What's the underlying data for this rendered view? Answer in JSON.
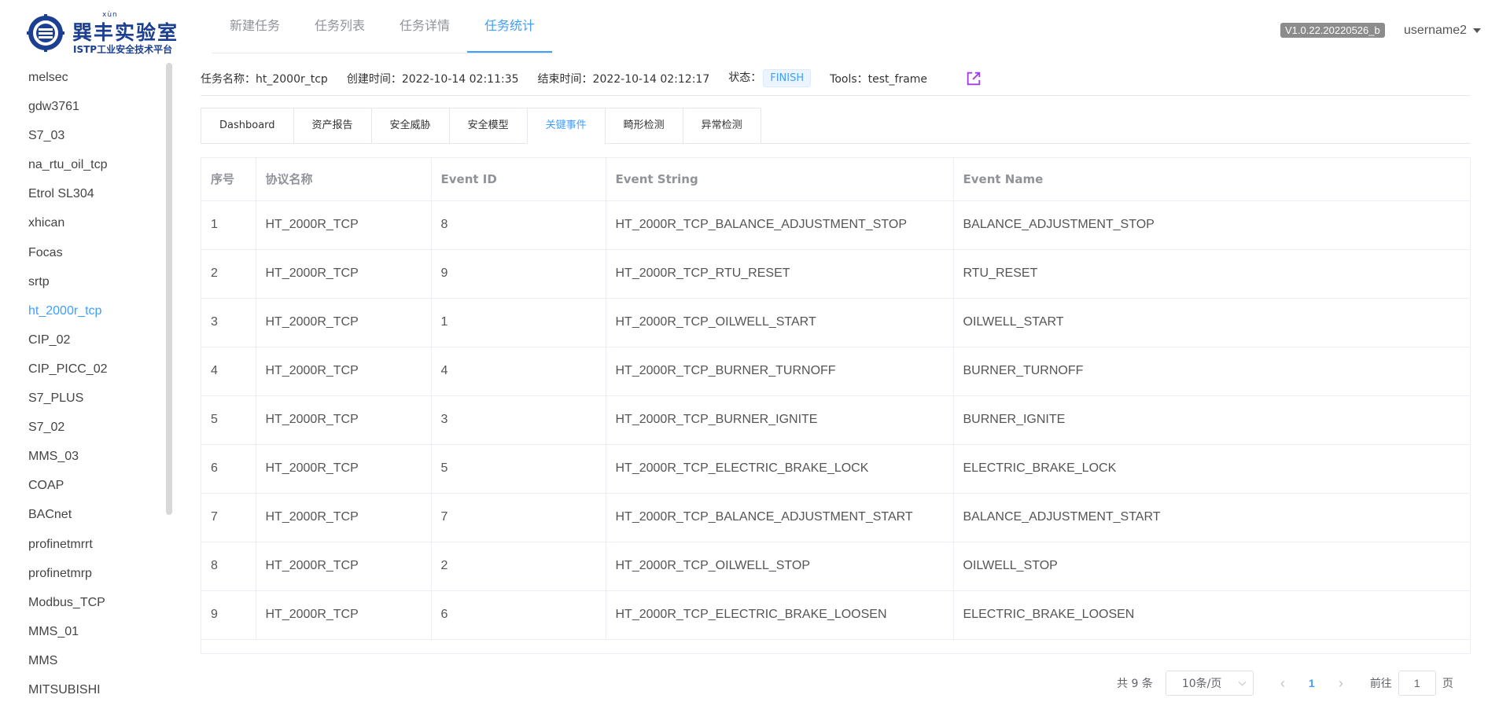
{
  "logo": {
    "pinyin": "xùn",
    "title": "巽丰实验室",
    "subtitle": "ISTP工业安全技术平台"
  },
  "topnav": {
    "items": [
      {
        "label": "新建任务"
      },
      {
        "label": "任务列表"
      },
      {
        "label": "任务详情"
      },
      {
        "label": "任务统计"
      }
    ],
    "active_index": 3
  },
  "version": "V1.0.22.20220526_b",
  "user": {
    "name": "username2"
  },
  "sidebar": {
    "items": [
      {
        "label": "melsec"
      },
      {
        "label": "gdw3761"
      },
      {
        "label": "S7_03"
      },
      {
        "label": "na_rtu_oil_tcp"
      },
      {
        "label": "Etrol SL304"
      },
      {
        "label": "xhican"
      },
      {
        "label": "Focas"
      },
      {
        "label": "srtp"
      },
      {
        "label": "ht_2000r_tcp"
      },
      {
        "label": "CIP_02"
      },
      {
        "label": "CIP_PICC_02"
      },
      {
        "label": "S7_PLUS"
      },
      {
        "label": "S7_02"
      },
      {
        "label": "MMS_03"
      },
      {
        "label": "COAP"
      },
      {
        "label": "BACnet"
      },
      {
        "label": "profinetmrrt"
      },
      {
        "label": "profinetmrp"
      },
      {
        "label": "Modbus_TCP"
      },
      {
        "label": "MMS_01"
      },
      {
        "label": "MMS"
      },
      {
        "label": "MITSUBISHI"
      }
    ],
    "active_index": 8
  },
  "task_info": {
    "name_label": "任务名称：",
    "name": "ht_2000r_tcp",
    "created_label": "创建时间：",
    "created": "2022-10-14 02:11:35",
    "ended_label": "结束时间：",
    "ended": "2022-10-14 02:12:17",
    "status_label": "状态：",
    "status": "FINISH",
    "tools_label": "Tools：",
    "tools": "test_frame"
  },
  "tabs": {
    "items": [
      {
        "label": "Dashboard"
      },
      {
        "label": "资产报告"
      },
      {
        "label": "安全威胁"
      },
      {
        "label": "安全模型"
      },
      {
        "label": "关键事件"
      },
      {
        "label": "畸形检测"
      },
      {
        "label": "异常检测"
      }
    ],
    "active_index": 4
  },
  "table": {
    "columns": [
      "序号",
      "协议名称",
      "Event ID",
      "Event String",
      "Event Name"
    ],
    "rows": [
      [
        "1",
        "HT_2000R_TCP",
        "8",
        "HT_2000R_TCP_BALANCE_ADJUSTMENT_STOP",
        "BALANCE_ADJUSTMENT_STOP"
      ],
      [
        "2",
        "HT_2000R_TCP",
        "9",
        "HT_2000R_TCP_RTU_RESET",
        "RTU_RESET"
      ],
      [
        "3",
        "HT_2000R_TCP",
        "1",
        "HT_2000R_TCP_OILWELL_START",
        "OILWELL_START"
      ],
      [
        "4",
        "HT_2000R_TCP",
        "4",
        "HT_2000R_TCP_BURNER_TURNOFF",
        "BURNER_TURNOFF"
      ],
      [
        "5",
        "HT_2000R_TCP",
        "3",
        "HT_2000R_TCP_BURNER_IGNITE",
        "BURNER_IGNITE"
      ],
      [
        "6",
        "HT_2000R_TCP",
        "5",
        "HT_2000R_TCP_ELECTRIC_BRAKE_LOCK",
        "ELECTRIC_BRAKE_LOCK"
      ],
      [
        "7",
        "HT_2000R_TCP",
        "7",
        "HT_2000R_TCP_BALANCE_ADJUSTMENT_START",
        "BALANCE_ADJUSTMENT_START"
      ],
      [
        "8",
        "HT_2000R_TCP",
        "2",
        "HT_2000R_TCP_OILWELL_STOP",
        "OILWELL_STOP"
      ],
      [
        "9",
        "HT_2000R_TCP",
        "6",
        "HT_2000R_TCP_ELECTRIC_BRAKE_LOOSEN",
        "ELECTRIC_BRAKE_LOOSEN"
      ]
    ]
  },
  "pagination": {
    "total": "共 9 条",
    "page_size": "10条/页",
    "current_page": "1",
    "goto_label": "前往",
    "goto_value": "1",
    "page_suffix": "页"
  },
  "colors": {
    "accent": "#409eff",
    "brand": "#1c3f91",
    "external_link_icon": "#a23be6"
  },
  "icons": {
    "external": "external-link-icon",
    "prev": "chevron-left-icon",
    "next": "chevron-right-icon",
    "dropdown": "chevron-down-icon",
    "user_menu": "caret-down-icon"
  }
}
